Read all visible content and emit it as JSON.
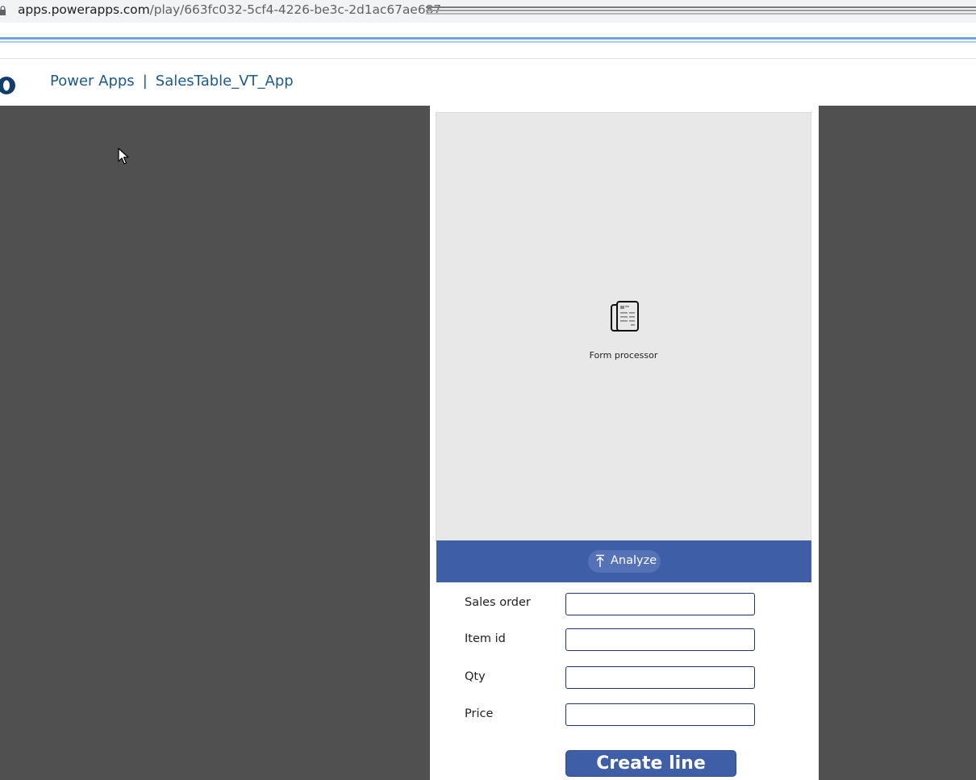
{
  "browser": {
    "url_host": "apps.powerapps.com",
    "url_path": "/play/663fc032-5cf4-4226-be3c-2d1ac67ae687"
  },
  "header": {
    "product": "Power Apps",
    "separator": "|",
    "app_name": "SalesTable_VT_App"
  },
  "form_processor": {
    "label": "Form processor",
    "analyze_label": "Analyze"
  },
  "fields": [
    {
      "label": "Sales order",
      "value": ""
    },
    {
      "label": "Item id",
      "value": ""
    },
    {
      "label": "Qty",
      "value": ""
    },
    {
      "label": "Price",
      "value": ""
    }
  ],
  "create_button": {
    "label": "Create line"
  },
  "colors": {
    "stage": "#505050",
    "accent": "#3f5ea8",
    "title": "#1b5a8a",
    "input_border": "#20336e"
  }
}
